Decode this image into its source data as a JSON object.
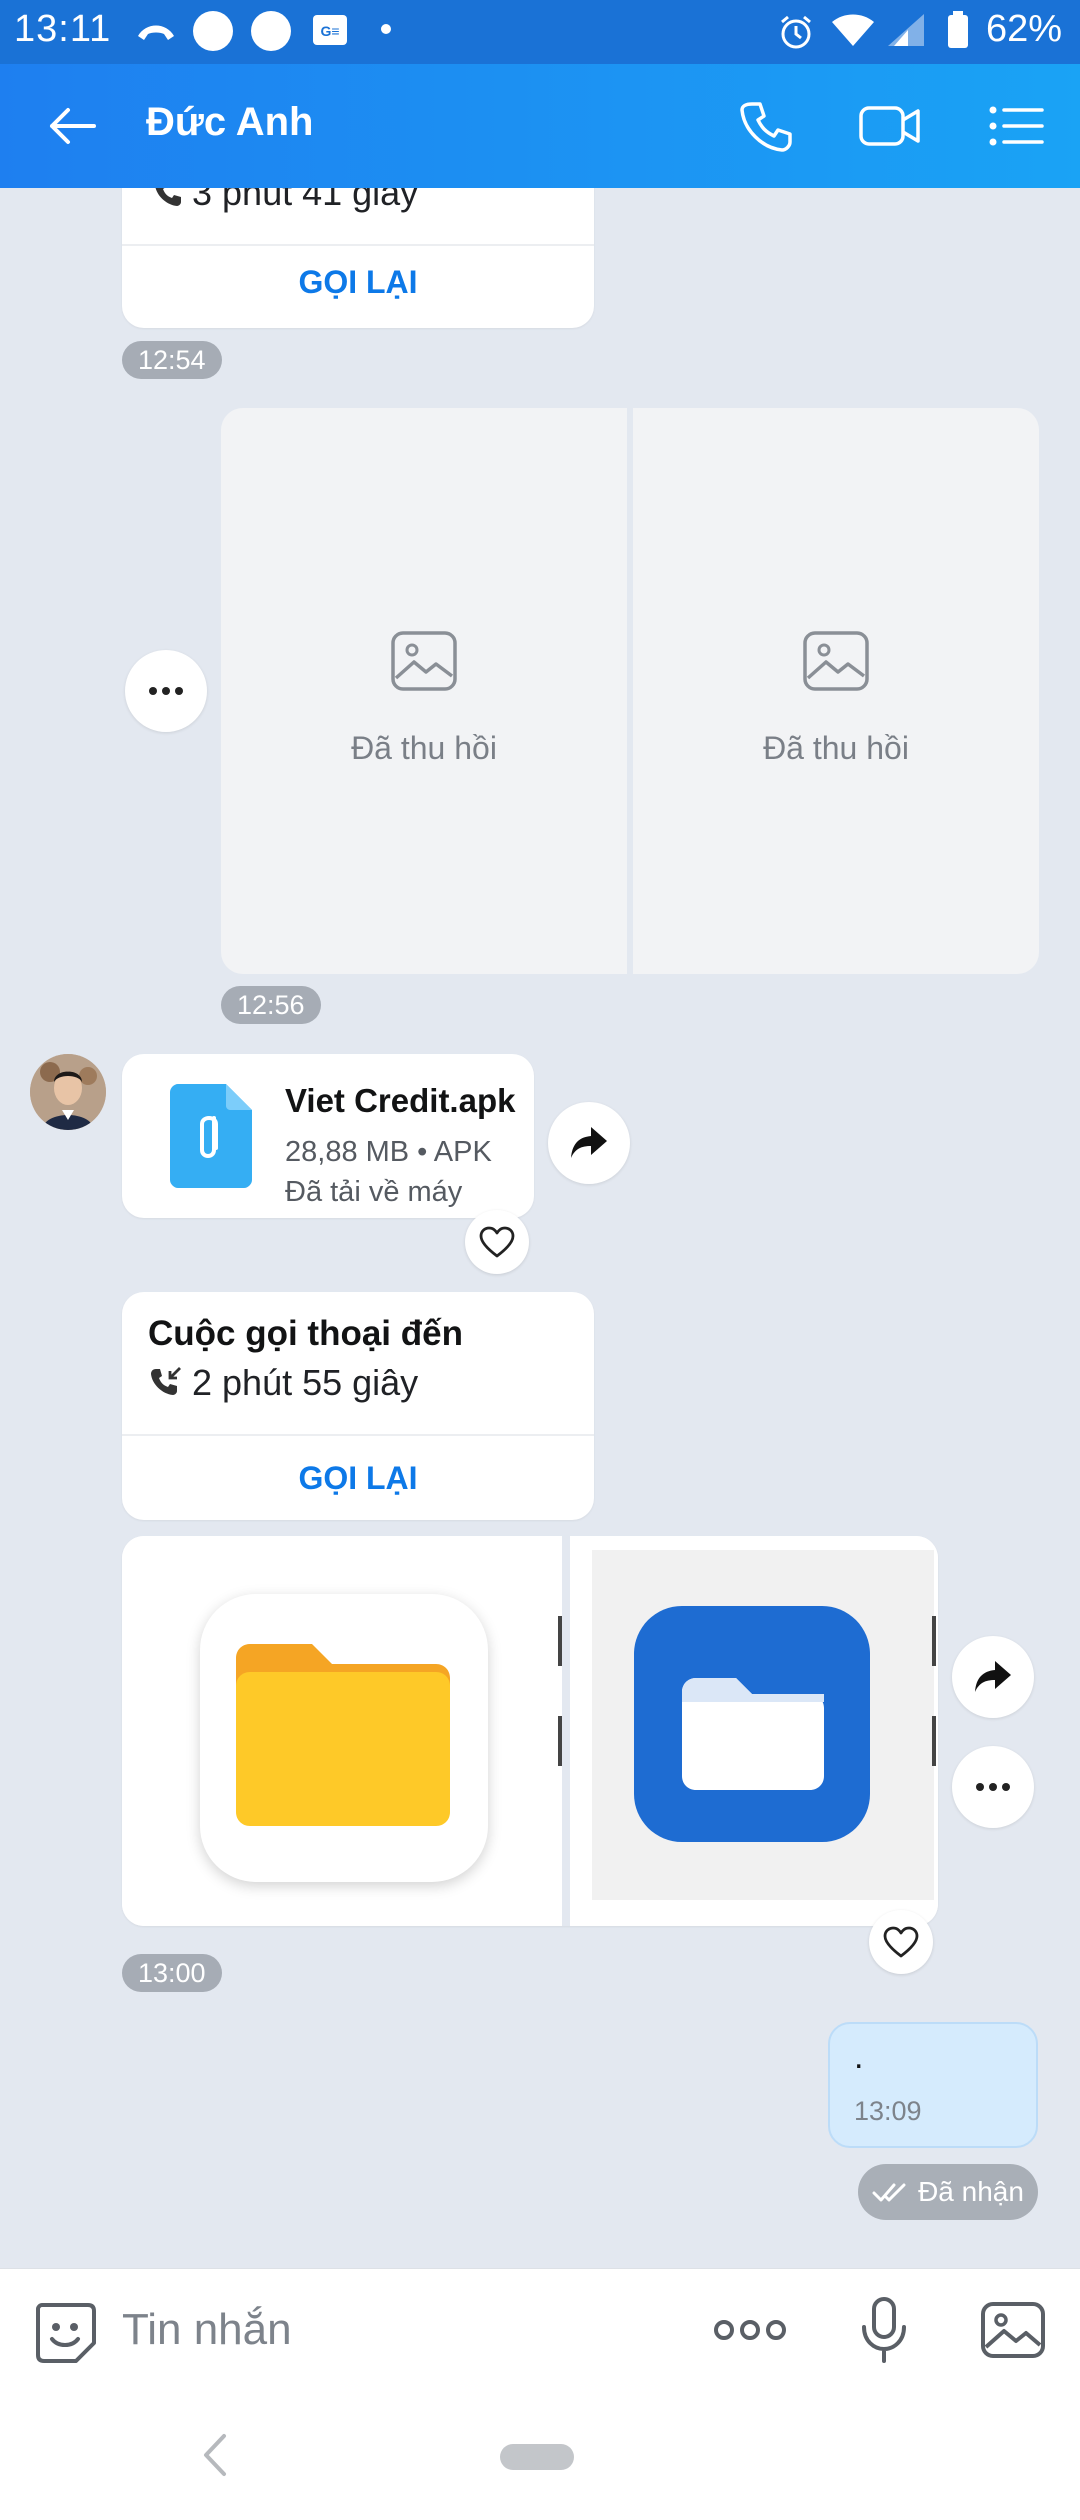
{
  "status_bar": {
    "time": "13:11",
    "battery": "62%"
  },
  "header": {
    "title": "Đức Anh"
  },
  "messages": {
    "call1": {
      "duration": "3 phút 41 giây",
      "callback_label": "GỌI LẠI"
    },
    "time1": "12:54",
    "recalled": [
      {
        "label": "Đã thu hồi"
      },
      {
        "label": "Đã thu hồi"
      }
    ],
    "time2": "12:56",
    "file": {
      "name": "Viet Credit.apk",
      "meta": "28,88 MB • APK",
      "status": "Đã tải về máy"
    },
    "call2": {
      "title": "Cuộc gọi thoại đến",
      "duration": "2 phút 55 giây",
      "callback_label": "GỌI LẠI"
    },
    "time3": "13:00",
    "outgoing": {
      "text": ".",
      "time": "13:09",
      "status": "Đã nhận"
    }
  },
  "composer": {
    "placeholder": "Tin nhắn"
  },
  "colors": {
    "header_start": "#1e7ff0",
    "header_end": "#1aa3f5",
    "accent": "#0d79e8",
    "outgoing_bubble": "#d5ebfd",
    "chat_bg": "#e3e8f0"
  }
}
